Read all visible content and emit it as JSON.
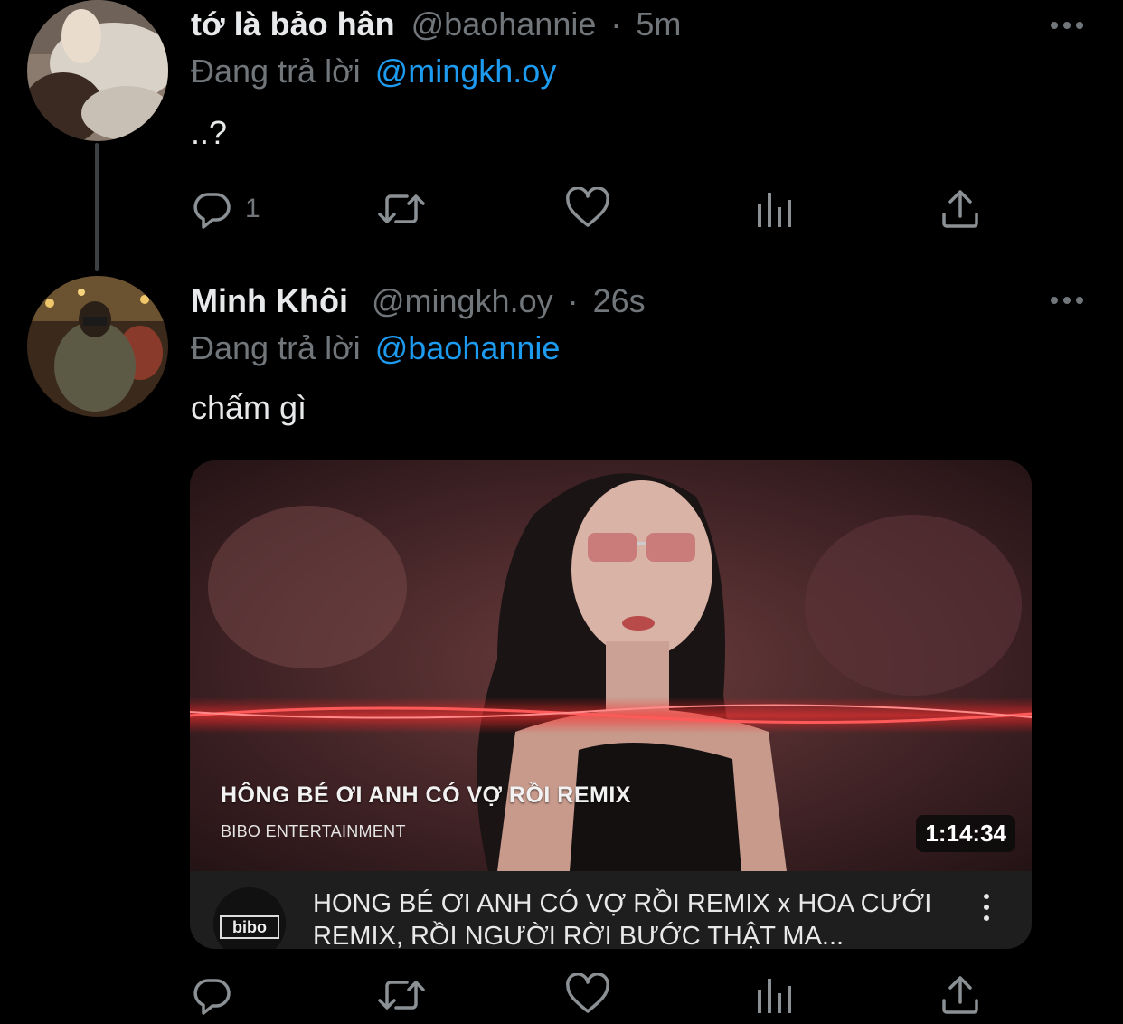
{
  "tweets": [
    {
      "display_name": "tớ là bảo hân",
      "handle": "@baohannie",
      "separator": "·",
      "time": "5m",
      "replying_prefix": "Đang trả lời",
      "replying_to": "@mingkh.oy",
      "text": "..?",
      "reply_count": "1"
    },
    {
      "display_name": "Minh Khôi",
      "handle": "@mingkh.oy",
      "separator": "·",
      "time": "26s",
      "replying_prefix": "Đang trả lời",
      "replying_to": "@baohannie",
      "text": "chấm gì",
      "reply_count": ""
    }
  ],
  "video_card": {
    "thumbnail_title": "HÔNG BÉ ƠI ANH CÓ VỢ RỒI REMIX",
    "thumbnail_subtitle": "BIBO ENTERTAINMENT",
    "duration": "1:14:34",
    "title": "HONG BÉ ƠI ANH CÓ VỢ RỒI REMIX x HOA CƯỚI REMIX, RỒI NGƯỜI RỜI BƯỚC THẬT MA...",
    "channel_logo_text": "bibo"
  },
  "icons": {
    "reply": "reply-icon",
    "retweet": "retweet-icon",
    "like": "heart-icon",
    "analytics": "analytics-icon",
    "share": "share-icon",
    "more": "more-dots-icon"
  },
  "colors": {
    "background": "#000000",
    "text": "#e7e9ea",
    "secondary": "#71767b",
    "mention": "#1d9bf0"
  }
}
